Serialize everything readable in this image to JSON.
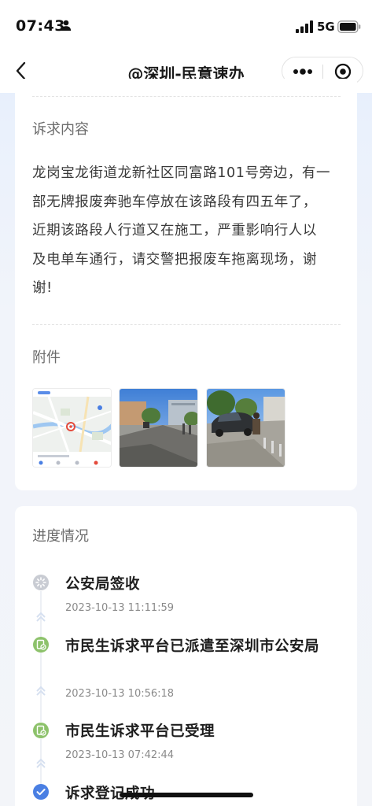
{
  "status_bar": {
    "time": "07:43",
    "network": "5G",
    "icons": [
      "person-icon",
      "signal-icon",
      "battery-icon"
    ]
  },
  "nav": {
    "title": "@深圳-民意速办",
    "back_icon": "chevron-left-icon",
    "more_icon": "more-dots-icon",
    "close_icon": "target-circle-icon"
  },
  "complaint": {
    "label": "诉求内容",
    "lines": [
      "龙岗宝龙街道龙新社区同富路101号旁边，有一",
      "部无牌报废奔驰车停放在该路段有四五年了，",
      "近期该路段人行道又在施工，严重影响行人以",
      "及电单车通行，请交警把报废车拖离现场，谢",
      "谢!"
    ]
  },
  "attachments": {
    "label": "附件",
    "items": [
      "map-screenshot-thumbnail",
      "street-photo-thumbnail",
      "car-photo-thumbnail"
    ]
  },
  "progress": {
    "label": "进度情况",
    "steps": [
      {
        "title": "公安局签收",
        "time": "2023-10-13 11:11:59",
        "status": "pending",
        "icon": "loading-icon"
      },
      {
        "title": "市民生诉求平台已派遣至深圳市公安局",
        "time": "2023-10-13 10:56:18",
        "status": "done",
        "icon": "document-check-icon"
      },
      {
        "title": "市民生诉求平台已受理",
        "time": "2023-10-13 07:42:44",
        "status": "done",
        "icon": "document-check-icon"
      },
      {
        "title": "诉求登记成功",
        "time": "",
        "status": "success",
        "icon": "check-circle-icon"
      }
    ]
  },
  "colors": {
    "accent_green": "#8dc26b",
    "accent_blue": "#4a7fe3",
    "pending_gray": "#c9ccd3",
    "text_primary": "#1e1e1e",
    "text_secondary": "#8a8a8a"
  }
}
